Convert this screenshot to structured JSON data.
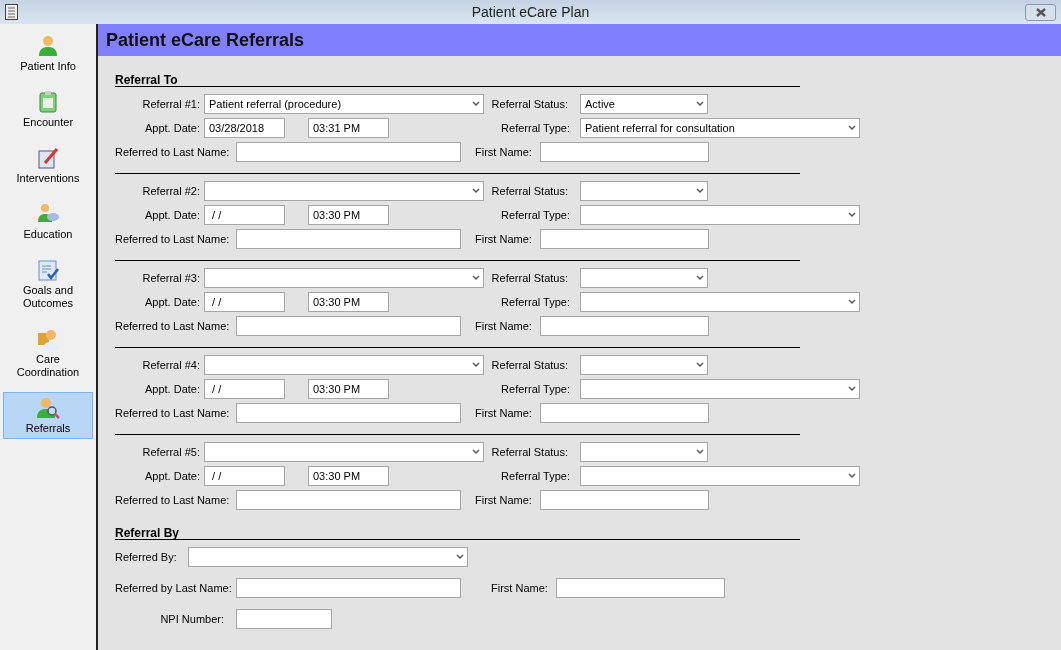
{
  "window": {
    "title": "Patient eCare Plan"
  },
  "sidebar": {
    "items": [
      {
        "label": "Patient Info",
        "selected": false
      },
      {
        "label": "Encounter",
        "selected": false
      },
      {
        "label": "Interventions",
        "selected": false
      },
      {
        "label": "Education",
        "selected": false
      },
      {
        "label": "Goals and Outcomes",
        "selected": false
      },
      {
        "label": "Care Coordination",
        "selected": false
      },
      {
        "label": "Referrals",
        "selected": true
      }
    ]
  },
  "header": "Patient eCare Referrals",
  "referral_to": {
    "heading": "Referral To",
    "referrals": [
      {
        "referral_label": "Referral #1:",
        "referral": "Patient referral (procedure)",
        "status_label": "Referral Status:",
        "status": "Active",
        "date_label": "Appt. Date:",
        "date": "03/28/2018",
        "time": "03:31 PM",
        "type_label": "Referral Type:",
        "type": "Patient referral for consultation",
        "last_name_label": "Referred to Last Name:",
        "first_name_label": "First Name:"
      },
      {
        "referral_label": "Referral #2:",
        "status_label": "Referral Status:",
        "date_label": "Appt. Date:",
        "date": " / /",
        "time": "03:30 PM",
        "type_label": "Referral Type:",
        "last_name_label": "Referred to Last Name:",
        "first_name_label": "First Name:"
      },
      {
        "referral_label": "Referral #3:",
        "status_label": "Referral Status:",
        "date_label": "Appt. Date:",
        "date": " / /",
        "time": "03:30 PM",
        "type_label": "Referral Type:",
        "last_name_label": "Referred to Last Name:",
        "first_name_label": "First Name:"
      },
      {
        "referral_label": "Referral #4:",
        "status_label": "Referral Status:",
        "date_label": "Appt. Date:",
        "date": " / /",
        "time": "03:30 PM",
        "type_label": "Referral Type:",
        "last_name_label": "Referred to Last Name:",
        "first_name_label": "First Name:"
      },
      {
        "referral_label": "Referral #5:",
        "status_label": "Referral Status:",
        "date_label": "Appt. Date:",
        "date": " / /",
        "time": "03:30 PM",
        "type_label": "Referral Type:",
        "last_name_label": "Referred to Last Name:",
        "first_name_label": "First Name:"
      }
    ]
  },
  "referral_by": {
    "heading": "Referral By",
    "referred_by_label": "Referred By:",
    "last_name_label": "Referred by Last Name:",
    "first_name_label": "First Name:",
    "npi_label": "NPI Number:"
  }
}
